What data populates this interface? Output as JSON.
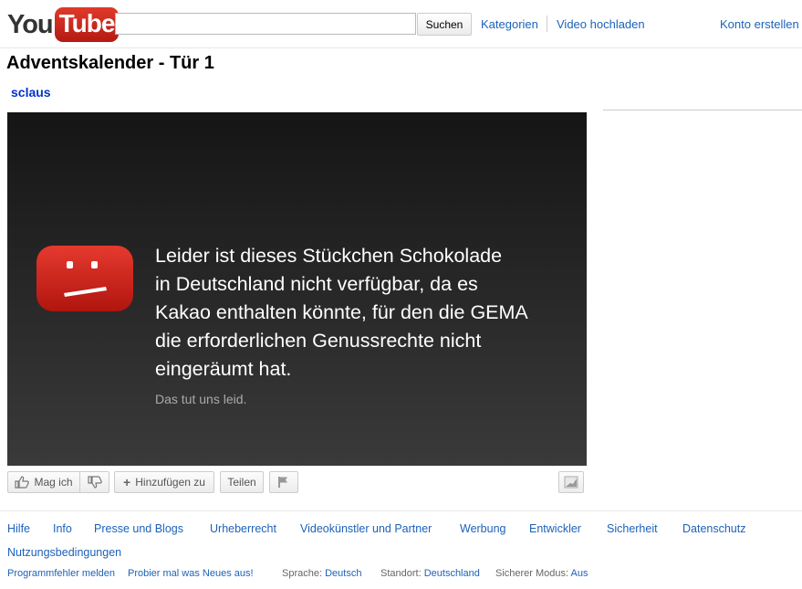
{
  "header": {
    "logo_you": "You",
    "logo_tube": "Tube",
    "search_value": "",
    "search_button": "Suchen",
    "links": [
      "Kategorien",
      "Video hochladen"
    ],
    "create_account": "Konto erstellen"
  },
  "video": {
    "title": "Adventskalender - Tür 1",
    "channel": "sclaus",
    "message_lines": [
      "Leider ist dieses Stückchen Schokolade",
      "in Deutschland nicht verfügbar, da es",
      "Kakao enthalten könnte, für den die GEMA",
      "die erforderlichen Genussrechte nicht",
      "eingeräumt hat."
    ],
    "sorry": "Das tut uns leid."
  },
  "actions": {
    "like": "Mag ich",
    "add_to": "Hinzufügen zu",
    "share": "Teilen"
  },
  "footer": {
    "links": [
      "Hilfe",
      "Info",
      "Presse und Blogs",
      "Urheberrecht",
      "Videokünstler und Partner",
      "Werbung",
      "Entwickler",
      "Sicherheit",
      "Datenschutz"
    ],
    "terms": "Nutzungsbedingungen",
    "bug_report": "Programmfehler melden",
    "try_new": "Probier mal was Neues aus!",
    "language_label": "Sprache:",
    "language_value": "Deutsch",
    "location_label": "Standort:",
    "location_value": "Deutschland",
    "safety_label": "Sicherer Modus:",
    "safety_value": "Aus"
  },
  "colors": {
    "link": "#1c62b9",
    "channel": "#0033cc",
    "logo_red": "#d12c1f"
  }
}
